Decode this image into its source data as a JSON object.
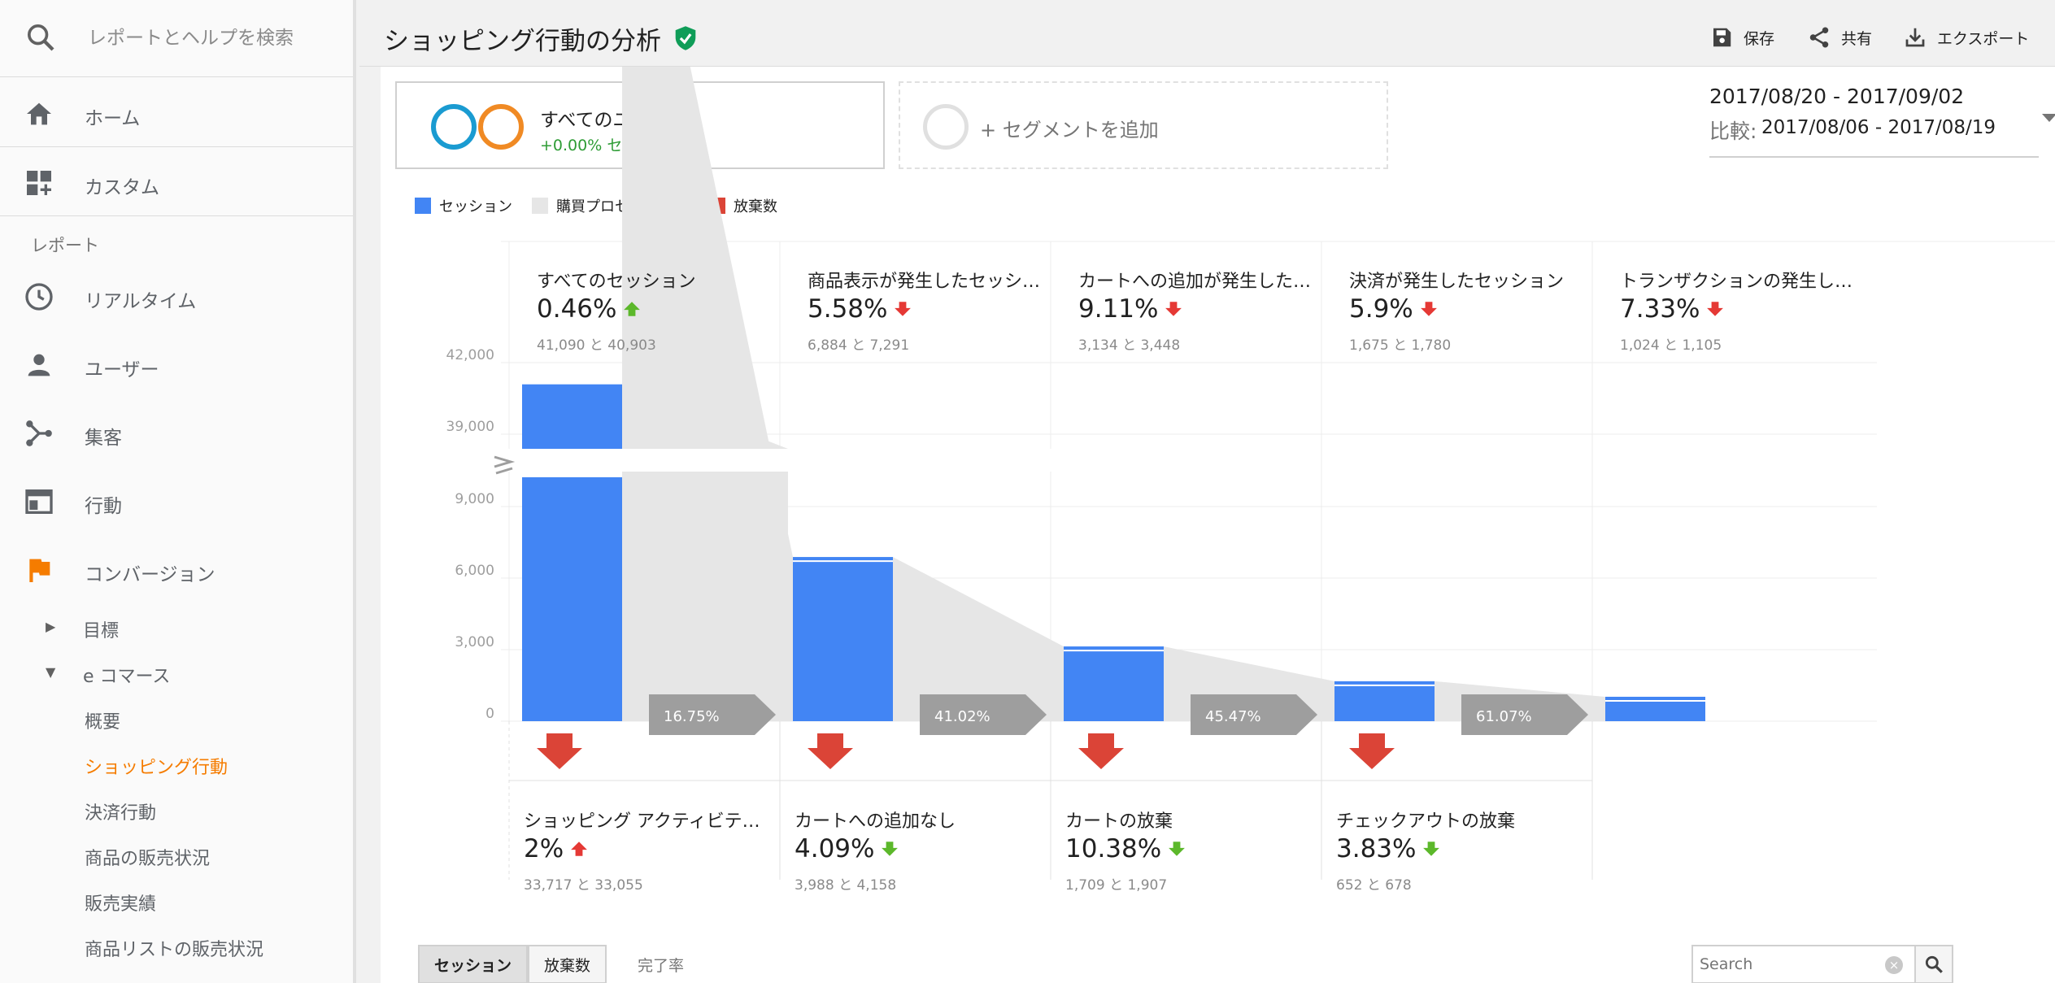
{
  "sidebar": {
    "search_placeholder": "レポートとヘルプを検索",
    "home": "ホーム",
    "custom": "カスタム",
    "reports_section": "レポート",
    "realtime": "リアルタイム",
    "audience": "ユーザー",
    "acquisition": "集客",
    "behavior": "行動",
    "conversions": "コンバージョン",
    "goals": "目標",
    "ecommerce": "e コマース",
    "ecommerce_items": [
      "概要",
      "ショッピング行動",
      "決済行動",
      "商品の販売状況",
      "販売実績",
      "商品リストの販売状況"
    ],
    "active_item": "ショッピング行動",
    "accent_color": "#f57c00"
  },
  "header": {
    "title": "ショッピング行動の分析",
    "save": "保存",
    "share": "共有",
    "export": "エクスポート"
  },
  "segments": {
    "segment_name": "すべてのユーザー",
    "segment_change": "+0.00% セッション",
    "add_segment": "+ セグメントを追加"
  },
  "date_range": {
    "current": "2017/08/20 - 2017/09/02",
    "compare_label": "比較:",
    "compare": "2017/08/06 - 2017/08/19"
  },
  "legend": [
    {
      "label": "セッション",
      "color": "#4285f4"
    },
    {
      "label": "購買プロセスの進捗",
      "color": "#e6e6e6"
    },
    {
      "label": "放棄数",
      "color": "#db4437"
    }
  ],
  "stages": [
    {
      "name": "すべてのセッション",
      "pct": "0.46%",
      "trend": "up",
      "compare": "41,090 と 40,903"
    },
    {
      "name": "商品表示が発生したセッシ…",
      "pct": "5.58%",
      "trend": "down",
      "compare": "6,884 と 7,291"
    },
    {
      "name": "カートへの追加が発生した…",
      "pct": "9.11%",
      "trend": "down",
      "compare": "3,134 と 3,448"
    },
    {
      "name": "決済が発生したセッション",
      "pct": "5.9%",
      "trend": "down",
      "compare": "1,675 と 1,780"
    },
    {
      "name": "トランザクションの発生し…",
      "pct": "7.33%",
      "trend": "down",
      "compare": "1,024 と 1,105"
    }
  ],
  "abandonments": [
    {
      "name": "ショッピング アクティビテ…",
      "pct": "2%",
      "trend": "up_red",
      "compare": "33,717 と 33,055"
    },
    {
      "name": "カートへの追加なし",
      "pct": "4.09%",
      "trend": "down_green",
      "compare": "3,988 と 4,158"
    },
    {
      "name": "カートの放棄",
      "pct": "10.38%",
      "trend": "down_green",
      "compare": "1,709 と 1,907"
    },
    {
      "name": "チェックアウトの放棄",
      "pct": "3.83%",
      "trend": "down_green",
      "compare": "652 と 678"
    }
  ],
  "chart_data": {
    "type": "bar",
    "categories": [
      "すべてのセッション",
      "商品表示が発生したセッシ…",
      "カートへの追加が発生した…",
      "決済が発生したセッション",
      "トランザクションの発生し…"
    ],
    "values": [
      41090,
      6884,
      3134,
      1675,
      1024
    ],
    "previous_values": [
      40903,
      7291,
      3448,
      1780,
      1105
    ],
    "conversion_rates": [
      "16.75%",
      "41.02%",
      "45.47%",
      "61.07%"
    ],
    "axis_ticks": [
      "0",
      "3,000",
      "6,000",
      "9,000",
      "39,000",
      "42,000"
    ],
    "axis_break": true,
    "bar_color": "#4285f4",
    "flow_color": "#e6e6e6",
    "abandon_color": "#db4437"
  },
  "bottom": {
    "tab_sessions": "セッション",
    "tab_abandon": "放棄数",
    "tab_completion": "完了率",
    "search_placeholder": "Search"
  }
}
